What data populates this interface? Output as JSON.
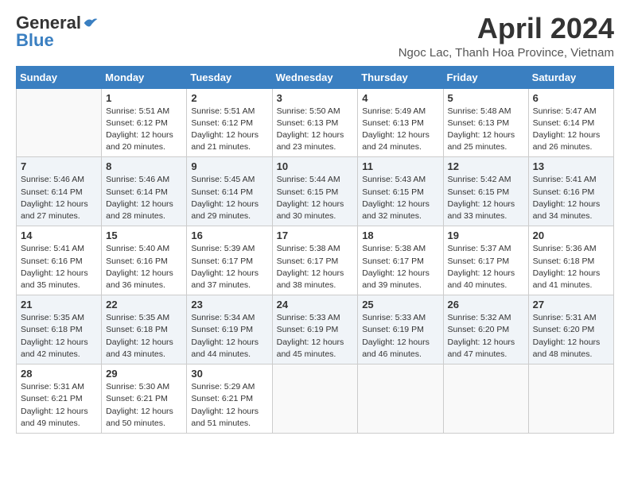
{
  "logo": {
    "general": "General",
    "blue": "Blue"
  },
  "title": "April 2024",
  "subtitle": "Ngoc Lac, Thanh Hoa Province, Vietnam",
  "days_of_week": [
    "Sunday",
    "Monday",
    "Tuesday",
    "Wednesday",
    "Thursday",
    "Friday",
    "Saturday"
  ],
  "weeks": [
    [
      {
        "day": "",
        "info": ""
      },
      {
        "day": "1",
        "info": "Sunrise: 5:51 AM\nSunset: 6:12 PM\nDaylight: 12 hours\nand 20 minutes."
      },
      {
        "day": "2",
        "info": "Sunrise: 5:51 AM\nSunset: 6:12 PM\nDaylight: 12 hours\nand 21 minutes."
      },
      {
        "day": "3",
        "info": "Sunrise: 5:50 AM\nSunset: 6:13 PM\nDaylight: 12 hours\nand 23 minutes."
      },
      {
        "day": "4",
        "info": "Sunrise: 5:49 AM\nSunset: 6:13 PM\nDaylight: 12 hours\nand 24 minutes."
      },
      {
        "day": "5",
        "info": "Sunrise: 5:48 AM\nSunset: 6:13 PM\nDaylight: 12 hours\nand 25 minutes."
      },
      {
        "day": "6",
        "info": "Sunrise: 5:47 AM\nSunset: 6:14 PM\nDaylight: 12 hours\nand 26 minutes."
      }
    ],
    [
      {
        "day": "7",
        "info": "Sunrise: 5:46 AM\nSunset: 6:14 PM\nDaylight: 12 hours\nand 27 minutes."
      },
      {
        "day": "8",
        "info": "Sunrise: 5:46 AM\nSunset: 6:14 PM\nDaylight: 12 hours\nand 28 minutes."
      },
      {
        "day": "9",
        "info": "Sunrise: 5:45 AM\nSunset: 6:14 PM\nDaylight: 12 hours\nand 29 minutes."
      },
      {
        "day": "10",
        "info": "Sunrise: 5:44 AM\nSunset: 6:15 PM\nDaylight: 12 hours\nand 30 minutes."
      },
      {
        "day": "11",
        "info": "Sunrise: 5:43 AM\nSunset: 6:15 PM\nDaylight: 12 hours\nand 32 minutes."
      },
      {
        "day": "12",
        "info": "Sunrise: 5:42 AM\nSunset: 6:15 PM\nDaylight: 12 hours\nand 33 minutes."
      },
      {
        "day": "13",
        "info": "Sunrise: 5:41 AM\nSunset: 6:16 PM\nDaylight: 12 hours\nand 34 minutes."
      }
    ],
    [
      {
        "day": "14",
        "info": "Sunrise: 5:41 AM\nSunset: 6:16 PM\nDaylight: 12 hours\nand 35 minutes."
      },
      {
        "day": "15",
        "info": "Sunrise: 5:40 AM\nSunset: 6:16 PM\nDaylight: 12 hours\nand 36 minutes."
      },
      {
        "day": "16",
        "info": "Sunrise: 5:39 AM\nSunset: 6:17 PM\nDaylight: 12 hours\nand 37 minutes."
      },
      {
        "day": "17",
        "info": "Sunrise: 5:38 AM\nSunset: 6:17 PM\nDaylight: 12 hours\nand 38 minutes."
      },
      {
        "day": "18",
        "info": "Sunrise: 5:38 AM\nSunset: 6:17 PM\nDaylight: 12 hours\nand 39 minutes."
      },
      {
        "day": "19",
        "info": "Sunrise: 5:37 AM\nSunset: 6:17 PM\nDaylight: 12 hours\nand 40 minutes."
      },
      {
        "day": "20",
        "info": "Sunrise: 5:36 AM\nSunset: 6:18 PM\nDaylight: 12 hours\nand 41 minutes."
      }
    ],
    [
      {
        "day": "21",
        "info": "Sunrise: 5:35 AM\nSunset: 6:18 PM\nDaylight: 12 hours\nand 42 minutes."
      },
      {
        "day": "22",
        "info": "Sunrise: 5:35 AM\nSunset: 6:18 PM\nDaylight: 12 hours\nand 43 minutes."
      },
      {
        "day": "23",
        "info": "Sunrise: 5:34 AM\nSunset: 6:19 PM\nDaylight: 12 hours\nand 44 minutes."
      },
      {
        "day": "24",
        "info": "Sunrise: 5:33 AM\nSunset: 6:19 PM\nDaylight: 12 hours\nand 45 minutes."
      },
      {
        "day": "25",
        "info": "Sunrise: 5:33 AM\nSunset: 6:19 PM\nDaylight: 12 hours\nand 46 minutes."
      },
      {
        "day": "26",
        "info": "Sunrise: 5:32 AM\nSunset: 6:20 PM\nDaylight: 12 hours\nand 47 minutes."
      },
      {
        "day": "27",
        "info": "Sunrise: 5:31 AM\nSunset: 6:20 PM\nDaylight: 12 hours\nand 48 minutes."
      }
    ],
    [
      {
        "day": "28",
        "info": "Sunrise: 5:31 AM\nSunset: 6:21 PM\nDaylight: 12 hours\nand 49 minutes."
      },
      {
        "day": "29",
        "info": "Sunrise: 5:30 AM\nSunset: 6:21 PM\nDaylight: 12 hours\nand 50 minutes."
      },
      {
        "day": "30",
        "info": "Sunrise: 5:29 AM\nSunset: 6:21 PM\nDaylight: 12 hours\nand 51 minutes."
      },
      {
        "day": "",
        "info": ""
      },
      {
        "day": "",
        "info": ""
      },
      {
        "day": "",
        "info": ""
      },
      {
        "day": "",
        "info": ""
      }
    ]
  ]
}
